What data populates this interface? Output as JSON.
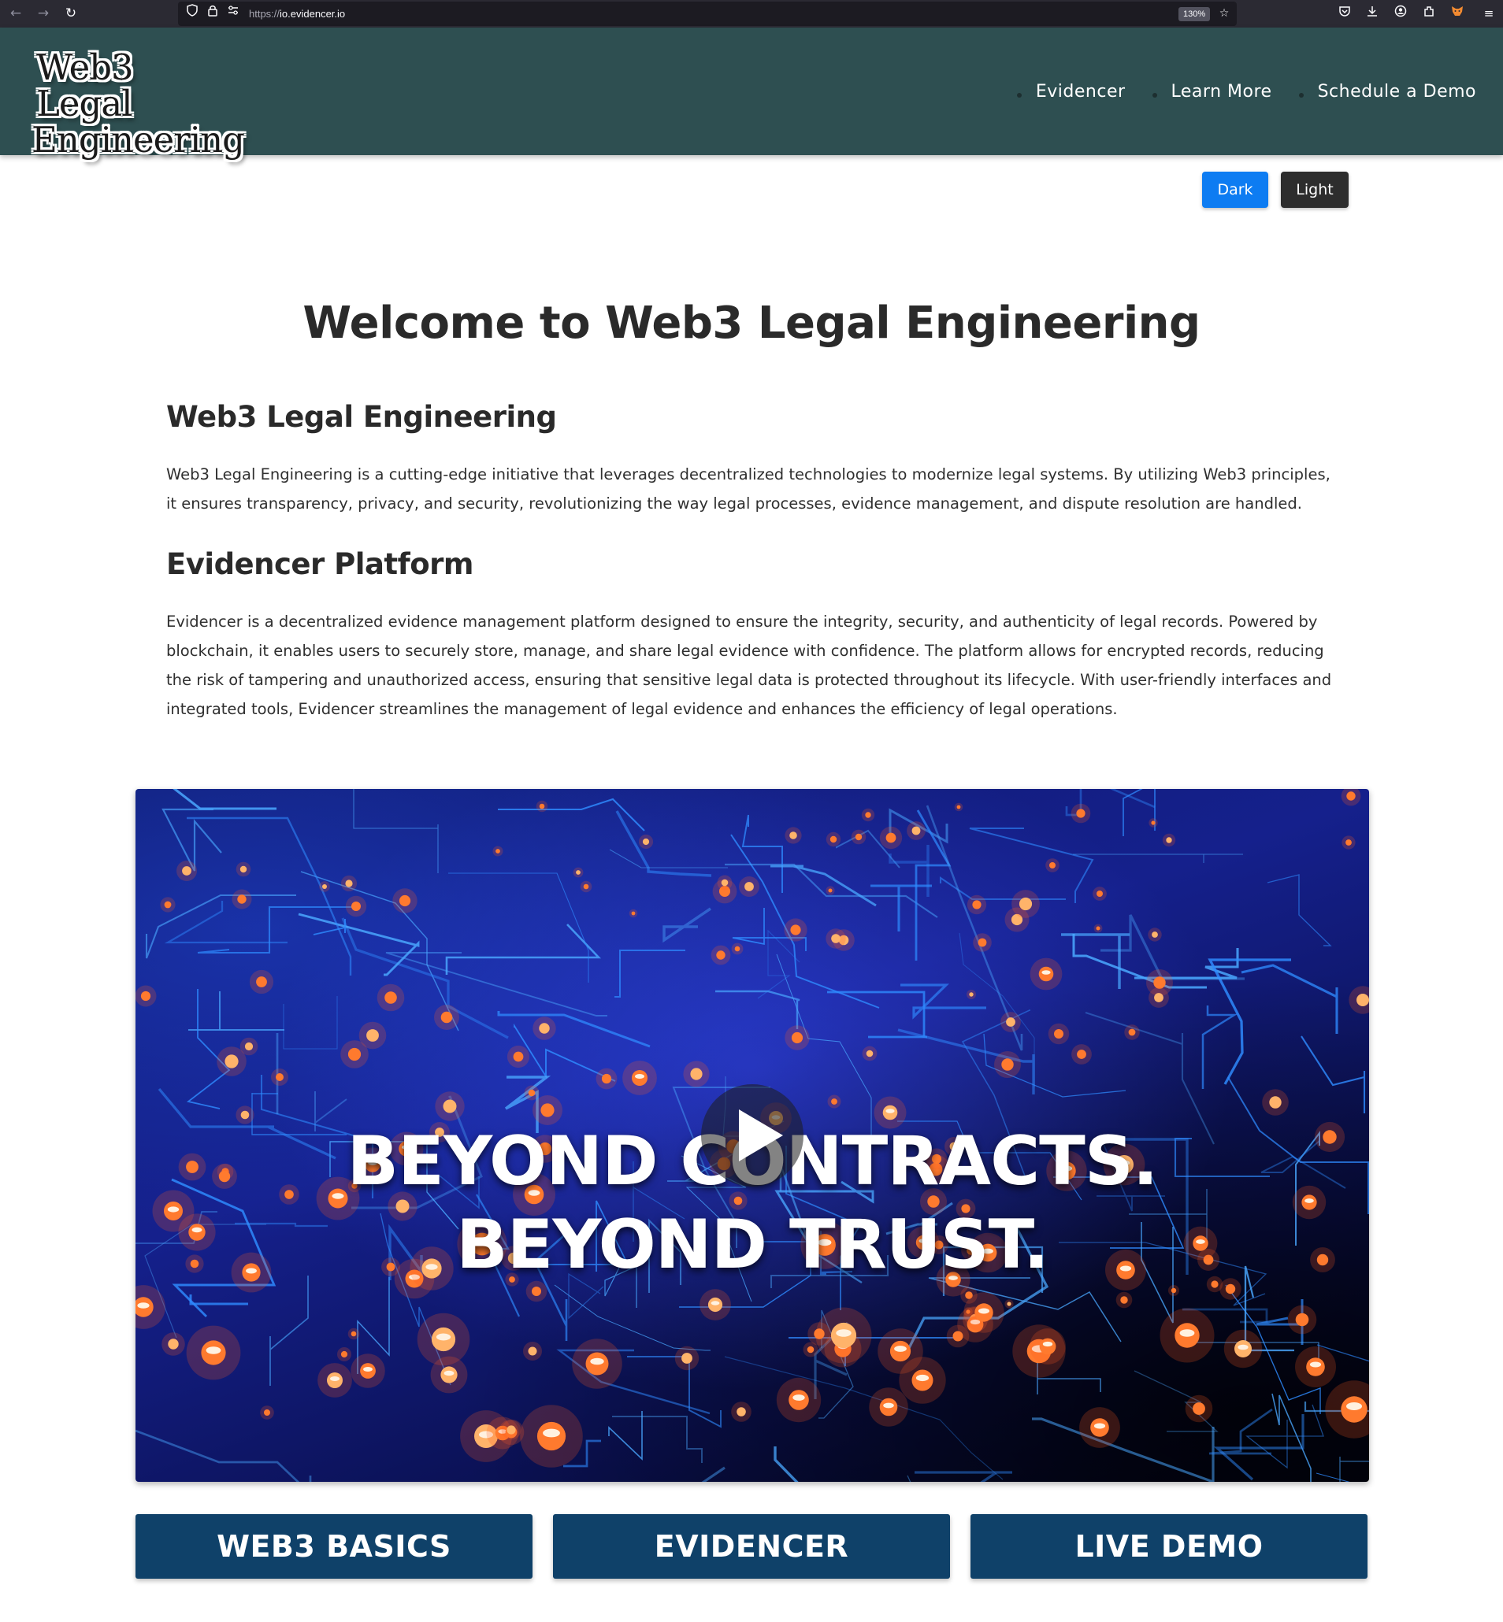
{
  "browser": {
    "back_icon": "←",
    "forward_icon": "→",
    "reload_icon": "↻",
    "url_protocol": "https://",
    "url_host": "io.evidencer.io",
    "zoom": "130%"
  },
  "header": {
    "logo_line1": "Web3 Legal",
    "logo_line2": "Engineering",
    "nav": [
      {
        "label": "Evidencer"
      },
      {
        "label": "Learn More"
      },
      {
        "label": "Schedule a Demo"
      }
    ]
  },
  "theme": {
    "dark_label": "Dark",
    "light_label": "Light"
  },
  "main": {
    "title": "Welcome to Web3 Legal Engineering",
    "sections": [
      {
        "heading": "Web3 Legal Engineering",
        "body": "Web3 Legal Engineering is a cutting-edge initiative that leverages decentralized technologies to modernize legal systems. By utilizing Web3 principles, it ensures transparency, privacy, and security, revolutionizing the way legal processes, evidence management, and dispute resolution are handled."
      },
      {
        "heading": "Evidencer Platform",
        "body": "Evidencer is a decentralized evidence management platform designed to ensure the integrity, security, and authenticity of legal records. Powered by blockchain, it enables users to securely store, manage, and share legal evidence with confidence. The platform allows for encrypted records, reducing the risk of tampering and unauthorized access, ensuring that sensitive legal data is protected throughout its lifecycle. With user-friendly interfaces and integrated tools, Evidencer streamlines the management of legal evidence and enhances the efficiency of legal operations."
      }
    ]
  },
  "video": {
    "caption_line1": "BEYOND CONTRACTS.",
    "caption_line2": "BEYOND TRUST."
  },
  "cta": [
    {
      "label": "WEB3 BASICS"
    },
    {
      "label": "EVIDENCER"
    },
    {
      "label": "LIVE DEMO"
    }
  ]
}
